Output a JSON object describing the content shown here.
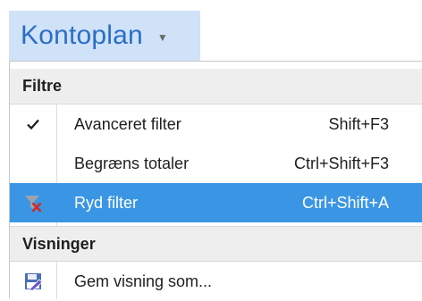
{
  "header": {
    "title": "Kontoplan",
    "caret_icon": "caret-down-icon"
  },
  "menu": {
    "sections": {
      "filters": "Filtre",
      "views": "Visninger"
    },
    "items": [
      {
        "label": "Avanceret filter",
        "shortcut": "Shift+F3",
        "checked": true,
        "icon": "checkmark-icon"
      },
      {
        "label": "Begræns totaler",
        "shortcut": "Ctrl+Shift+F3",
        "checked": false
      },
      {
        "label": "Ryd filter",
        "shortcut": "Ctrl+Shift+A",
        "selected": true,
        "icon": "clear-filter-icon"
      },
      {
        "label": "Gem visning som...",
        "shortcut": "",
        "icon": "save-view-icon"
      }
    ]
  },
  "colors": {
    "title_bg": "#cfe2f8",
    "title_text": "#2a6ec6",
    "selected_bg": "#3a96e4",
    "section_bg": "#eeeeee"
  }
}
